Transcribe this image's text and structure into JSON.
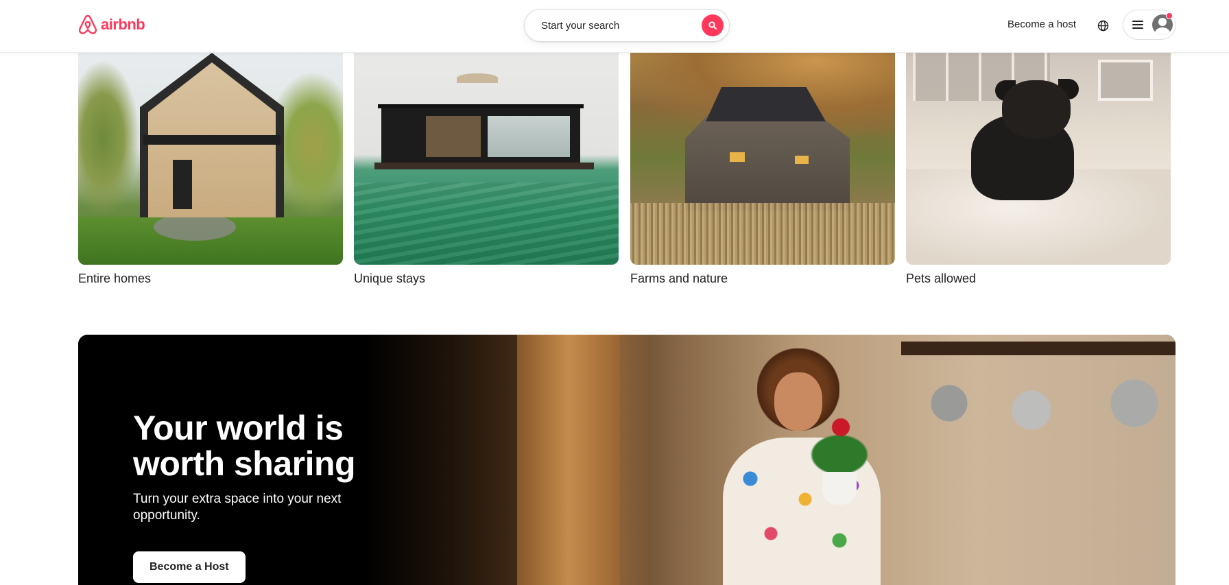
{
  "header": {
    "logo_text": "airbnb",
    "brand_color": "#FF385C",
    "search_placeholder": "Start your search",
    "host_link": "Become a host",
    "icons": [
      "airbnb-logo-icon",
      "search-icon",
      "globe-icon",
      "menu-icon",
      "avatar-icon"
    ]
  },
  "categories": [
    {
      "label": "Entire homes"
    },
    {
      "label": "Unique stays"
    },
    {
      "label": "Farms and nature"
    },
    {
      "label": "Pets allowed"
    }
  ],
  "host_banner": {
    "title_line1": "Your world is",
    "title_line2": "worth sharing",
    "subtitle": "Turn your extra space into your next opportunity.",
    "button_label": "Become a Host"
  }
}
